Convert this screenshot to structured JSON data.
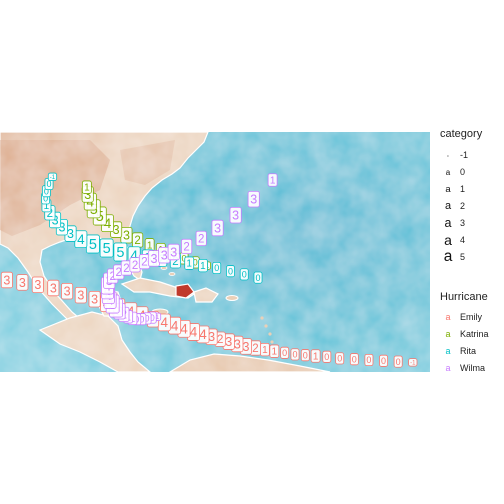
{
  "legend": {
    "category_title": "category",
    "category_items": [
      {
        "label": "-1",
        "key": "a",
        "size": 4
      },
      {
        "label": "0",
        "key": "a",
        "size": 8
      },
      {
        "label": "1",
        "key": "a",
        "size": 9.5
      },
      {
        "label": "2",
        "key": "a",
        "size": 11
      },
      {
        "label": "3",
        "key": "a",
        "size": 12.5
      },
      {
        "label": "4",
        "key": "a",
        "size": 14
      },
      {
        "label": "5",
        "key": "a",
        "size": 15.5
      }
    ],
    "hurricane_title": "Hurricane",
    "hurricane_items": [
      {
        "label": "Emily",
        "key": "a",
        "color": "#f8766d"
      },
      {
        "label": "Katrina",
        "key": "a",
        "color": "#7cae00"
      },
      {
        "label": "Rita",
        "key": "a",
        "color": "#00bfc4"
      },
      {
        "label": "Wilma",
        "key": "a",
        "color": "#c77cff"
      }
    ]
  },
  "map": {
    "basemap": "watercolor",
    "colors": {
      "ocean": "#5cc0d6",
      "land": "#e7c9ad",
      "land_dark": "#d9a07c",
      "haiti_fill": "#c0392b"
    }
  },
  "chart_data": {
    "type": "scatter",
    "title": "",
    "xlabel": "",
    "ylabel": "",
    "xlim": [
      -100,
      -50
    ],
    "ylim": [
      10,
      40
    ],
    "series": [
      {
        "name": "Emily",
        "color": "#f8766d",
        "x": [
          -52,
          -53.7,
          -55.4,
          -57.1,
          -58.8,
          -60.5,
          -62,
          -63.3,
          -64.5,
          -65.7,
          -66.9,
          -68.1,
          -69.2,
          -70.3,
          -71.4,
          -72.4,
          -73.4,
          -74.4,
          -75.4,
          -76.4,
          -77.5,
          -78.6,
          -79.7,
          -80.9,
          -82.2,
          -83.5,
          -84.8,
          -86.2,
          -87.6,
          -89,
          -90.6,
          -92.2,
          -93.8,
          -95.6,
          -97.4,
          -99.2
        ],
        "y": [
          11.2,
          11.3,
          11.4,
          11.5,
          11.6,
          11.7,
          11.9,
          12.0,
          12.1,
          12.2,
          12.4,
          12.6,
          12.8,
          13.0,
          13.2,
          13.5,
          13.8,
          14.1,
          14.4,
          14.7,
          15.0,
          15.4,
          15.8,
          16.2,
          16.6,
          17.1,
          17.6,
          18.1,
          18.6,
          19.1,
          19.6,
          20.1,
          20.5,
          20.9,
          21.2,
          21.5
        ],
        "category": [
          -1,
          0,
          0,
          0,
          0,
          0,
          0,
          1,
          0,
          0,
          0,
          1,
          1,
          2,
          3,
          3,
          3,
          2,
          3,
          4,
          4,
          4,
          4,
          4,
          3,
          4,
          4,
          4,
          4,
          3,
          3,
          3,
          3,
          3,
          3,
          3
        ]
      },
      {
        "name": "Katrina",
        "color": "#7cae00",
        "x": [
          -76,
          -77.3,
          -78.6,
          -80,
          -81.3,
          -82.6,
          -84,
          -85.3,
          -86.5,
          -87.5,
          -88.4,
          -89.1,
          -89.5,
          -89.8,
          -89.9
        ],
        "y": [
          23.3,
          23.7,
          24.2,
          24.7,
          25.3,
          25.9,
          26.5,
          27.1,
          27.8,
          28.6,
          29.5,
          30.4,
          31.3,
          32.2,
          33.1
        ],
        "category": [
          -1,
          0,
          0,
          0,
          1,
          1,
          2,
          3,
          3,
          4,
          5,
          5,
          4,
          3,
          1
        ]
      },
      {
        "name": "Rita",
        "color": "#00bfc4",
        "x": [
          -70,
          -71.6,
          -73.2,
          -74.8,
          -76.4,
          -78,
          -79.6,
          -81.2,
          -82.8,
          -84.4,
          -86,
          -87.6,
          -89.2,
          -90.6,
          -91.8,
          -92.8,
          -93.6,
          -94.2,
          -94.6,
          -94.7,
          -94.6,
          -94.3,
          -93.9
        ],
        "y": [
          21.8,
          22.2,
          22.6,
          23.0,
          23.3,
          23.6,
          23.9,
          24.1,
          24.3,
          24.6,
          25.0,
          25.5,
          26.0,
          26.6,
          27.3,
          28.1,
          29.0,
          29.9,
          30.8,
          31.7,
          32.6,
          33.5,
          34.4
        ],
        "category": [
          0,
          0,
          0,
          0,
          1,
          1,
          2,
          2,
          3,
          4,
          5,
          5,
          5,
          4,
          3,
          3,
          3,
          2,
          1,
          0,
          0,
          0,
          -1
        ]
      },
      {
        "name": "Wilma",
        "color": "#c77cff",
        "x": [
          -81.8,
          -82.3,
          -82.9,
          -83.5,
          -84.1,
          -84.6,
          -85.1,
          -85.6,
          -86.1,
          -86.5,
          -86.9,
          -87.2,
          -87.4,
          -87.5,
          -87.5,
          -87.3,
          -86.9,
          -86.2,
          -85.3,
          -84.3,
          -83.2,
          -82.1,
          -80.9,
          -79.8
        ],
        "y": [
          16.9,
          16.8,
          16.7,
          16.6,
          16.6,
          16.7,
          16.9,
          17.2,
          17.6,
          18.0,
          18.5,
          19.0,
          19.6,
          20.2,
          20.8,
          21.4,
          22.0,
          22.5,
          23.0,
          23.4,
          23.8,
          24.2,
          24.6,
          25.0
        ],
        "category": [
          -1,
          0,
          0,
          0,
          0,
          1,
          1,
          2,
          3,
          5,
          5,
          4,
          4,
          4,
          4,
          3,
          2,
          2,
          2,
          2,
          2,
          3,
          3,
          3
        ]
      },
      {
        "name": "Wilma",
        "color": "#c77cff",
        "x": [
          -78.3,
          -76.6,
          -74.7,
          -72.6,
          -70.5,
          -68.3
        ],
        "y": [
          25.7,
          26.7,
          28.0,
          29.6,
          31.6,
          34.0
        ],
        "category": [
          2,
          2,
          3,
          3,
          3,
          1
        ]
      }
    ]
  }
}
